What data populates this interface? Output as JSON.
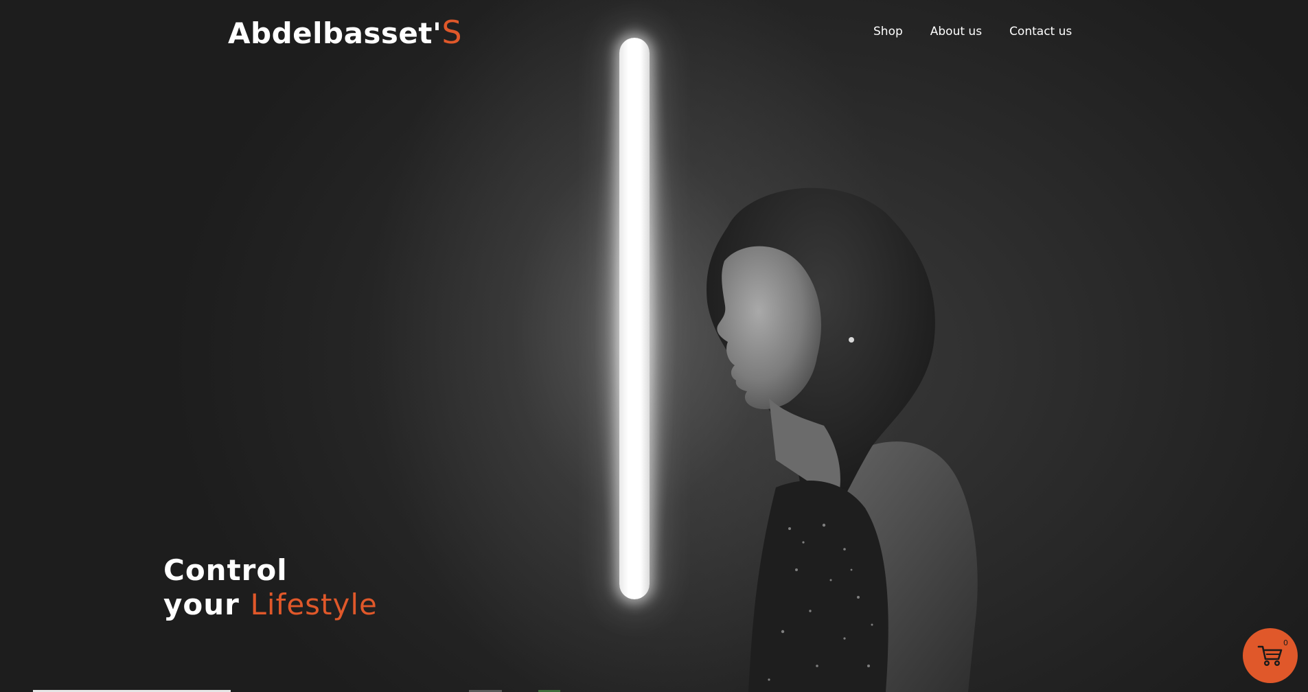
{
  "header": {
    "brand_main": "Abdelbasset'",
    "brand_accent": "S",
    "nav": [
      {
        "label": "Shop"
      },
      {
        "label": "About us"
      },
      {
        "label": "Contact us"
      }
    ]
  },
  "hero": {
    "line1": "Control",
    "line2_prefix": "your ",
    "line2_accent": "Lifestyle"
  },
  "cart": {
    "count": "0",
    "icon": "shopping-cart-icon"
  },
  "colors": {
    "accent": "#e0582a",
    "text": "#ffffff",
    "background": "#2a2a2a"
  }
}
